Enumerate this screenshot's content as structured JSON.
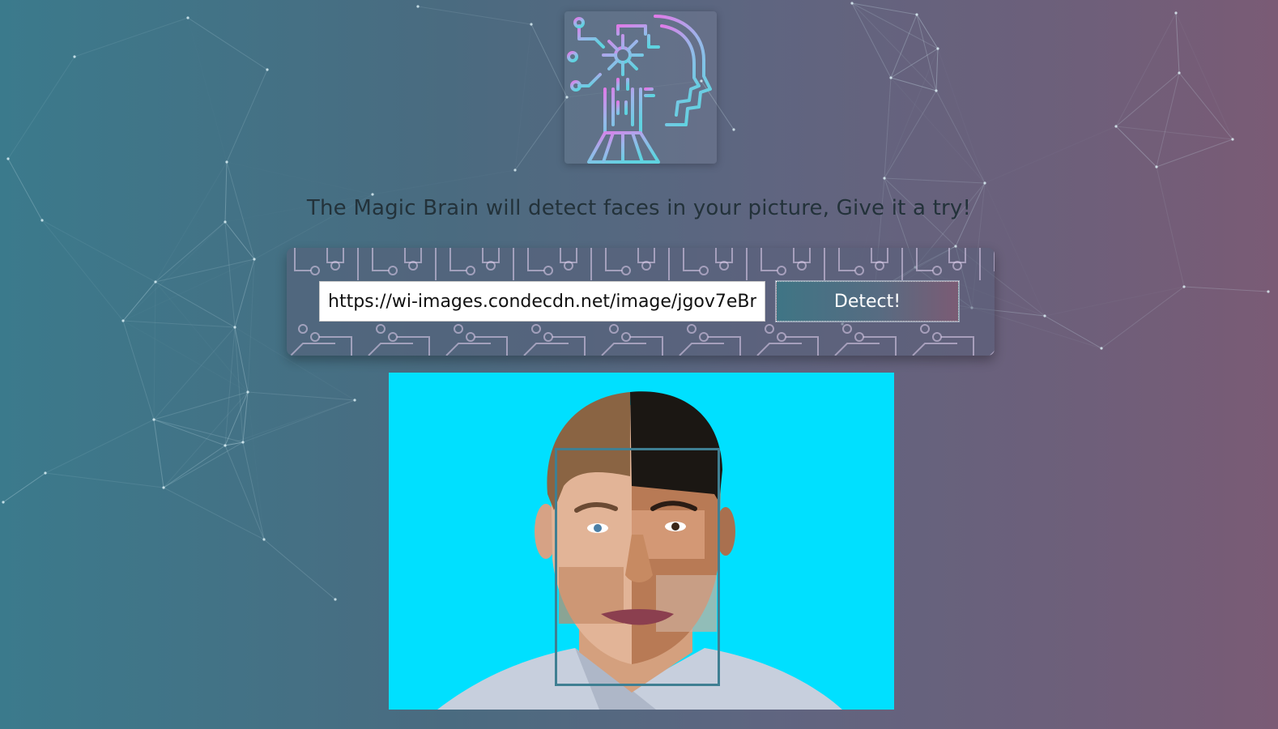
{
  "app": {
    "tagline": "The Magic Brain will detect faces in your picture, Give it a try!"
  },
  "logo": {
    "icon": "brain-circuit-head-icon",
    "colors": [
      "#e07be8",
      "#5fd3e0"
    ]
  },
  "form": {
    "url_value": "https://wi-images.condecdn.net/image/jgov7eBr",
    "detect_label": "Detect!"
  },
  "result": {
    "background_color": "#00e0ff",
    "faces_detected": 1,
    "box_color": "#3f7f92"
  },
  "colors": {
    "bg_left": "#3b7a8c",
    "bg_right": "#7a5b75",
    "tagline_text": "#23323a"
  }
}
